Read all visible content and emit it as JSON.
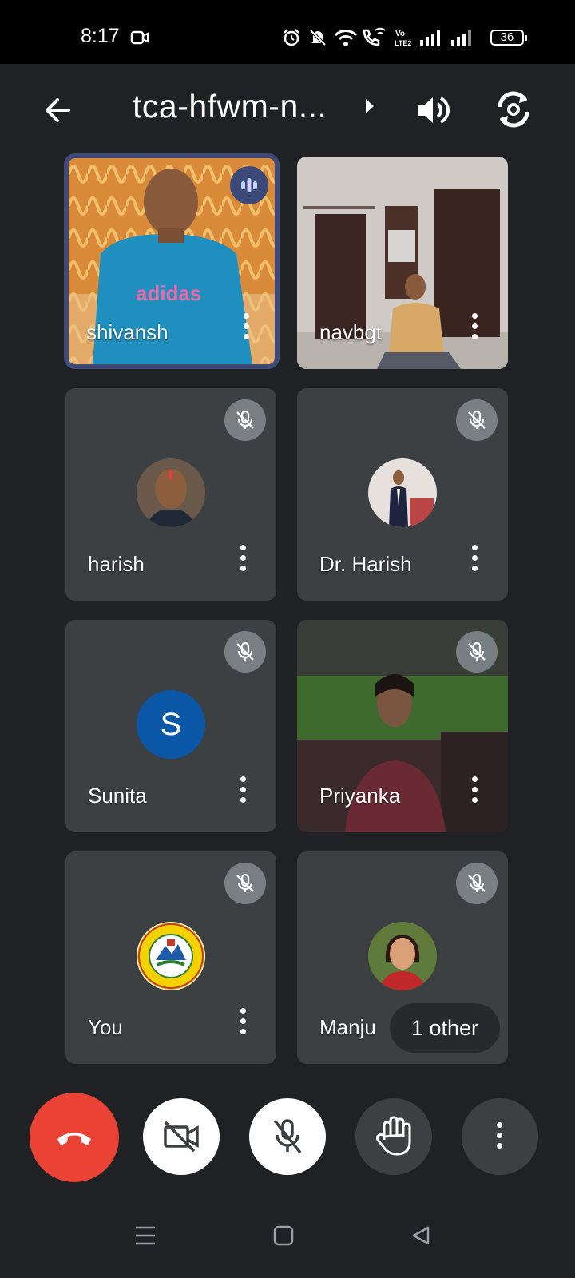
{
  "status_bar": {
    "time": "8:17",
    "battery": "36",
    "icons": [
      "video-recording-icon",
      "alarm-icon",
      "mute-notifications-icon",
      "wifi-icon",
      "wifi-calling-icon",
      "volte-icon",
      "signal-icon",
      "signal-icon"
    ]
  },
  "app_bar": {
    "meeting_code": "tca-hfwm-n...",
    "icons": [
      "back-arrow-icon",
      "expand-arrow-icon",
      "speaker-icon",
      "switch-camera-icon"
    ]
  },
  "participants": [
    {
      "name": "shivansh",
      "state": "speaking"
    },
    {
      "name": "navbgt",
      "state": "video"
    },
    {
      "name": "harish",
      "state": "muted"
    },
    {
      "name": "Dr. Harish",
      "state": "muted"
    },
    {
      "name": "Sunita",
      "state": "muted",
      "initial": "S"
    },
    {
      "name": "Priyanka",
      "state": "muted"
    },
    {
      "name": "You",
      "state": "muted"
    },
    {
      "name": "Manju",
      "state": "muted"
    }
  ],
  "others_pill": "1 other",
  "controls": [
    "end-call-button",
    "camera-off-button",
    "mic-off-button",
    "raise-hand-button",
    "more-options-button"
  ],
  "colors": {
    "background": "#202124",
    "tile": "#3c4043",
    "end_call": "#ea4335",
    "speaking_border": "#3f4a78",
    "sunita_avatar": "#0b57a7"
  }
}
